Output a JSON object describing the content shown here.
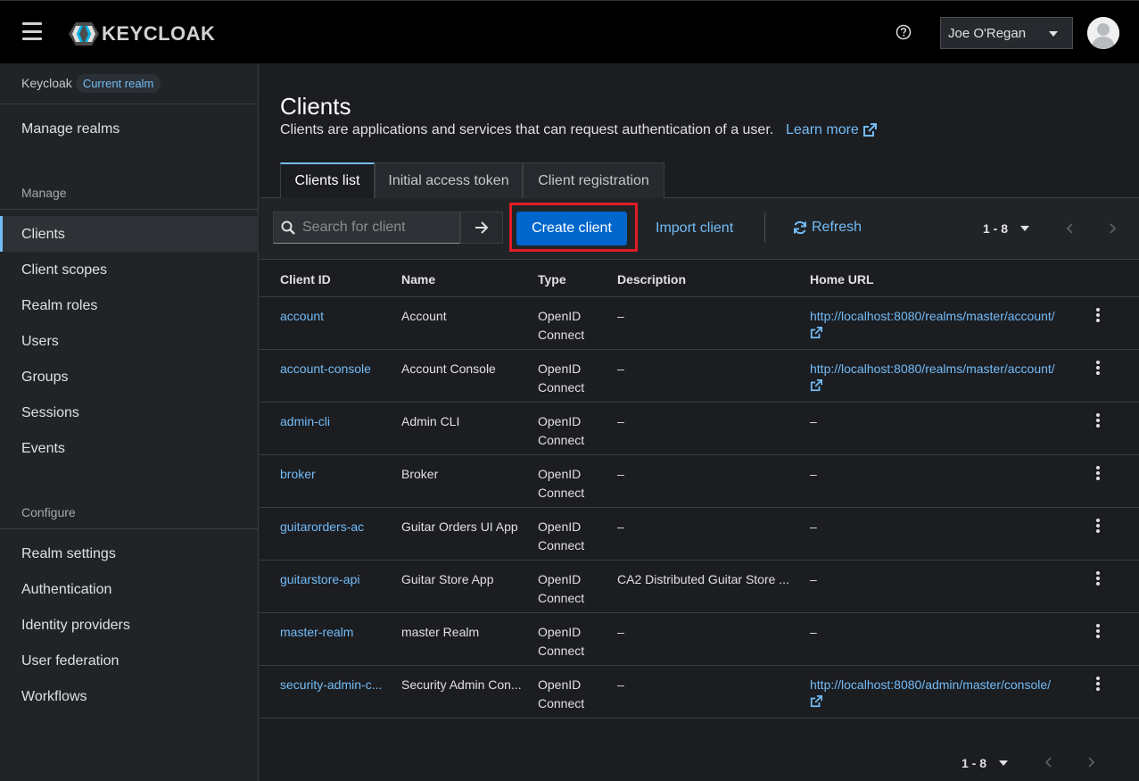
{
  "header": {
    "logo_text": "KEYCLOAK",
    "user_name": "Joe O'Regan"
  },
  "sidebar": {
    "realm_label": "Keycloak",
    "realm_badge": "Current realm",
    "manage_realms": "Manage realms",
    "manage_section": "Manage",
    "manage_items": [
      "Clients",
      "Client scopes",
      "Realm roles",
      "Users",
      "Groups",
      "Sessions",
      "Events"
    ],
    "configure_section": "Configure",
    "configure_items": [
      "Realm settings",
      "Authentication",
      "Identity providers",
      "User federation",
      "Workflows"
    ]
  },
  "page": {
    "title": "Clients",
    "subtitle": "Clients are applications and services that can request authentication of a user.",
    "learn_more": "Learn more"
  },
  "tabs": [
    "Clients list",
    "Initial access token",
    "Client registration"
  ],
  "toolbar": {
    "search_placeholder": "Search for client",
    "create_label": "Create client",
    "import_label": "Import client",
    "refresh_label": "Refresh",
    "pagination": "1 - 8"
  },
  "table": {
    "columns": [
      "Client ID",
      "Name",
      "Type",
      "Description",
      "Home URL"
    ],
    "rows": [
      {
        "client_id": "account",
        "name": "Account",
        "type1": "OpenID",
        "type2": "Connect",
        "description": "–",
        "home_url": "http://localhost:8080/realms/master/account/",
        "has_url": true
      },
      {
        "client_id": "account-console",
        "name": "Account Console",
        "type1": "OpenID",
        "type2": "Connect",
        "description": "–",
        "home_url": "http://localhost:8080/realms/master/account/",
        "has_url": true
      },
      {
        "client_id": "admin-cli",
        "name": "Admin CLI",
        "type1": "OpenID",
        "type2": "Connect",
        "description": "–",
        "home_url": "–",
        "has_url": false
      },
      {
        "client_id": "broker",
        "name": "Broker",
        "type1": "OpenID",
        "type2": "Connect",
        "description": "–",
        "home_url": "–",
        "has_url": false
      },
      {
        "client_id": "guitarorders-ac",
        "name": "Guitar Orders UI App",
        "type1": "OpenID",
        "type2": "Connect",
        "description": "–",
        "home_url": "–",
        "has_url": false
      },
      {
        "client_id": "guitarstore-api",
        "name": "Guitar Store App",
        "type1": "OpenID",
        "type2": "Connect",
        "description": "CA2 Distributed Guitar Store ...",
        "home_url": "–",
        "has_url": false
      },
      {
        "client_id": "master-realm",
        "name": "master Realm",
        "type1": "OpenID",
        "type2": "Connect",
        "description": "–",
        "home_url": "–",
        "has_url": false
      },
      {
        "client_id": "security-admin-c...",
        "name": "Security Admin Con...",
        "type1": "OpenID",
        "type2": "Connect",
        "description": "–",
        "home_url": "http://localhost:8080/admin/master/console/",
        "has_url": true
      }
    ]
  },
  "footer": {
    "pagination": "1 - 8"
  },
  "colors": {
    "accent": "#73bcf7",
    "primary_button": "#0066cc",
    "highlight": "#e01c24"
  }
}
